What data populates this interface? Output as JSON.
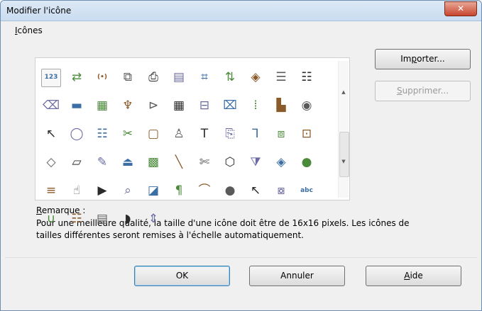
{
  "window": {
    "title": "Modifier l'icône",
    "close_glyph": "✕"
  },
  "group": {
    "label_prefix": "",
    "label_u": "I",
    "label_rest": "cônes"
  },
  "icons": [
    {
      "name": "123-field-icon",
      "glyph": "123"
    },
    {
      "name": "move-arrows-icon",
      "glyph": "⇄"
    },
    {
      "name": "parentheses-icon",
      "glyph": "(•)"
    },
    {
      "name": "shapes-icon",
      "glyph": "⧉"
    },
    {
      "name": "stamp-icon",
      "glyph": "⎙"
    },
    {
      "name": "table-icon",
      "glyph": "▤"
    },
    {
      "name": "puzzle-icon",
      "glyph": "⌗"
    },
    {
      "name": "sort-icon",
      "glyph": "⇅"
    },
    {
      "name": "eye-icon",
      "glyph": "◈"
    },
    {
      "name": "list-icon",
      "glyph": "☰"
    },
    {
      "name": "document-list-icon",
      "glyph": "☷"
    },
    {
      "name": "tag-icon",
      "glyph": "⌫"
    },
    {
      "name": "line-icon",
      "glyph": "▬"
    },
    {
      "name": "calendar-icon",
      "glyph": "▦"
    },
    {
      "name": "tools-icon",
      "glyph": "♆"
    },
    {
      "name": "close-arrow-icon",
      "glyph": "⊳"
    },
    {
      "name": "grid-icon",
      "glyph": "▦"
    },
    {
      "name": "fit-width-icon",
      "glyph": "⊟"
    },
    {
      "name": "image-icon",
      "glyph": "⌧"
    },
    {
      "name": "columns-icon",
      "glyph": "⦙"
    },
    {
      "name": "chart-icon",
      "glyph": "▙"
    },
    {
      "name": "record-icon",
      "glyph": "◉"
    },
    {
      "name": "pointer-icon",
      "glyph": "↖"
    },
    {
      "name": "circle-icon",
      "glyph": "◯"
    },
    {
      "name": "form-icon",
      "glyph": "☷"
    },
    {
      "name": "clip-icon",
      "glyph": "✂"
    },
    {
      "name": "rectangle-icon",
      "glyph": "▢"
    },
    {
      "name": "usb-icon",
      "glyph": "♙"
    },
    {
      "name": "text-icon",
      "glyph": "T"
    },
    {
      "name": "doc-image-icon",
      "glyph": "⎘"
    },
    {
      "name": "connector-icon",
      "glyph": "⅂"
    },
    {
      "name": "copy-icon",
      "glyph": "⧈"
    },
    {
      "name": "slider-icon",
      "glyph": "⊡"
    },
    {
      "name": "diamond-icon",
      "glyph": "◇"
    },
    {
      "name": "parallelogram-icon",
      "glyph": "▱"
    },
    {
      "name": "brush-icon",
      "glyph": "✎"
    },
    {
      "name": "stamp-green-icon",
      "glyph": "⏏"
    },
    {
      "name": "file-grid-icon",
      "glyph": "▩"
    },
    {
      "name": "diagonal-line-icon",
      "glyph": "╲"
    },
    {
      "name": "scissors-icon",
      "glyph": "✄"
    },
    {
      "name": "hexagon-icon",
      "glyph": "⬡"
    },
    {
      "name": "filter-icon",
      "glyph": "⧩"
    },
    {
      "name": "eye2-icon",
      "glyph": "◈"
    },
    {
      "name": "color-wheel-icon",
      "glyph": "●"
    },
    {
      "name": "align-center-icon",
      "glyph": "≡"
    },
    {
      "name": "hand-icon",
      "glyph": "☝"
    },
    {
      "name": "play-list-icon",
      "glyph": "▶"
    },
    {
      "name": "zoom-icon",
      "glyph": "⌕"
    },
    {
      "name": "shadow-shape-icon",
      "glyph": "◪"
    },
    {
      "name": "pilcrow-icon",
      "glyph": "¶"
    },
    {
      "name": "arc-icon",
      "glyph": "⌒"
    },
    {
      "name": "sphere-icon",
      "glyph": "●"
    },
    {
      "name": "arrow-pointer-icon",
      "glyph": "↖"
    },
    {
      "name": "gallery-icon",
      "glyph": "⧇"
    },
    {
      "name": "spellcheck-icon",
      "glyph": "abc"
    },
    {
      "name": "curve-icon",
      "glyph": "∪"
    },
    {
      "name": "form2-icon",
      "glyph": "☷"
    },
    {
      "name": "text-frame-icon",
      "glyph": "▤"
    },
    {
      "name": "sound-icon",
      "glyph": "◗"
    },
    {
      "name": "spin-icon",
      "glyph": "⇕"
    }
  ],
  "buttons": {
    "import_a": "Im",
    "import_u": "p",
    "import_b": "orter...",
    "delete_u": "S",
    "delete_b": "upprimer...",
    "ok": "OK",
    "cancel": "Annuler",
    "help_u": "A",
    "help_b": "ide"
  },
  "remark": {
    "label_u": "R",
    "label_rest": "emarque :",
    "text": "Pour une meilleure qualité, la taille d'une icône doit être de 16x16 pixels. Les icônes de tailles différentes seront remises à l'échelle automatiquement."
  },
  "scrollbar": {
    "up": "▲",
    "down": "▼"
  },
  "colors": {
    "accent": "#3c7fb1",
    "close": "#c7452f"
  }
}
